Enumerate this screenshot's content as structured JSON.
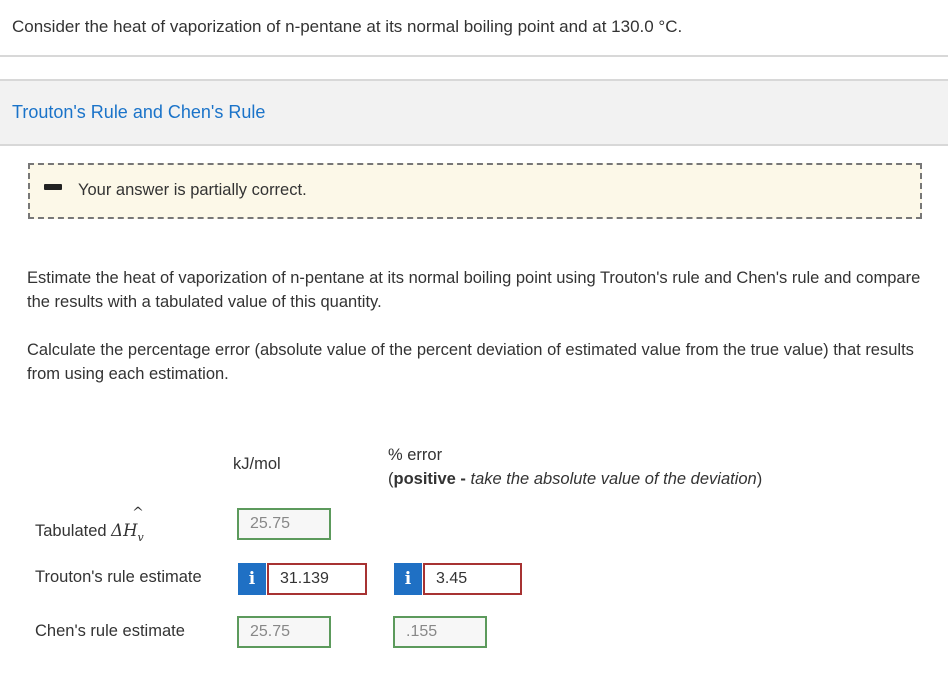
{
  "question": {
    "text": "Consider the heat of vaporization of n-pentane at its normal boiling point and at 130.0 °C."
  },
  "section": {
    "title": "Trouton's Rule and Chen's Rule"
  },
  "feedback": {
    "icon": "partial-credit-icon",
    "text": "Your answer is partially correct."
  },
  "paragraphs": {
    "p1": "Estimate the heat of vaporization of n-pentane at its normal boiling point using Trouton's rule and Chen's rule and compare the results with a tabulated value of this quantity.",
    "p2": "Calculate the percentage error (absolute value of the percent deviation of estimated value from the true value) that results from using each estimation."
  },
  "table": {
    "col_units": "kJ/mol",
    "col_error_title": "% error",
    "col_error_open": "(",
    "col_error_bold": "positive -",
    "col_error_italic": " take the absolute value of the deviation",
    "col_error_close": ")",
    "rows": {
      "tabulated": {
        "label_prefix": "Tabulated ",
        "symbol": "ΔH",
        "hat": "^",
        "subscript": "v",
        "kj_value": "25.75"
      },
      "trouton": {
        "label": "Trouton's rule estimate",
        "kj_value": "31.139",
        "error_value": "3.45"
      },
      "chen": {
        "label": "Chen's rule estimate",
        "kj_value": "25.75",
        "error_value": ".155"
      }
    },
    "info_glyph": "i"
  },
  "colors": {
    "link_blue": "#1a73c9",
    "correct_border": "#5c9a5c",
    "wrong_border": "#a73232",
    "info_button": "#1f70c4",
    "feedback_bg": "#fcf8e8"
  }
}
